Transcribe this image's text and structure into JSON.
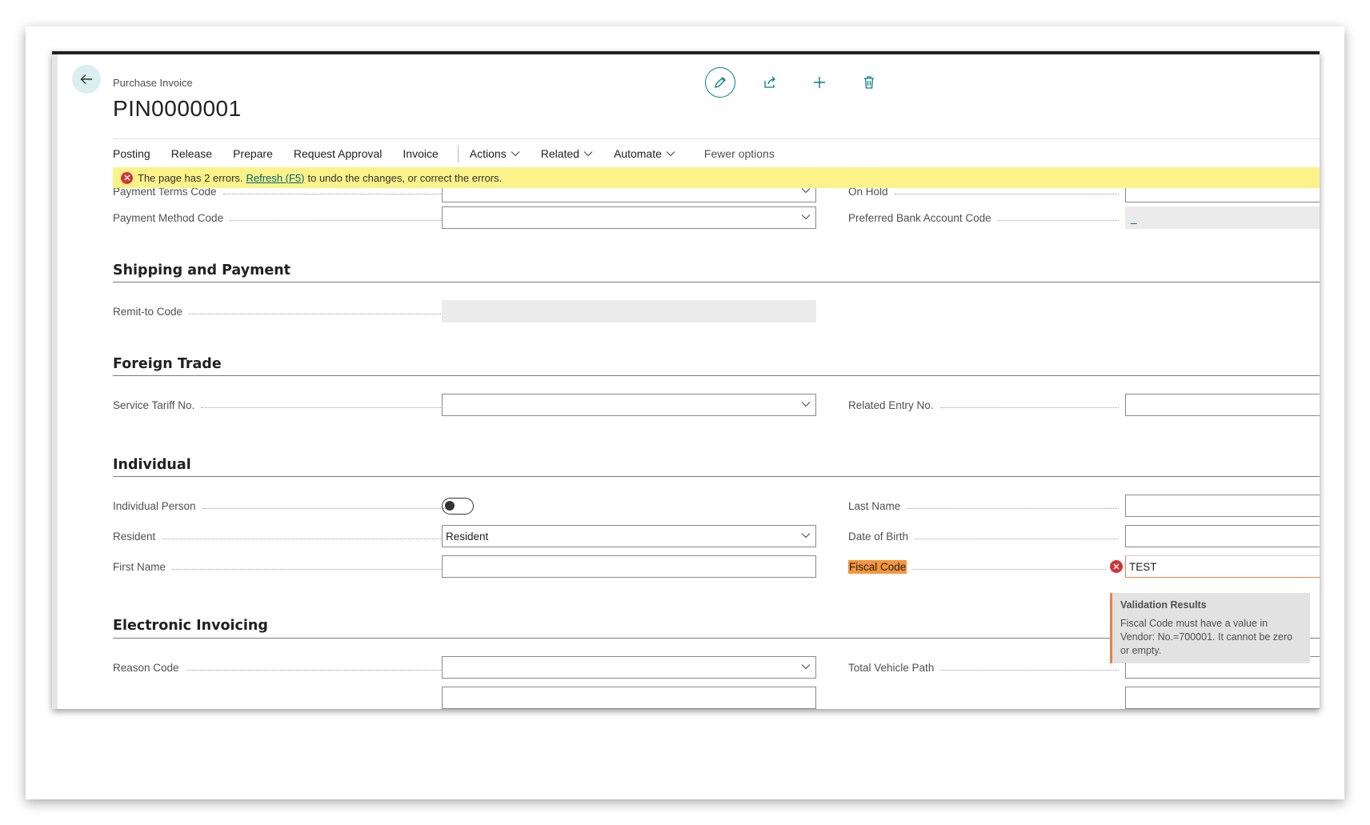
{
  "header": {
    "caption": "Purchase Invoice",
    "title": "PIN0000001"
  },
  "action_bar": {
    "items": [
      "Posting",
      "Release",
      "Prepare",
      "Request Approval",
      "Invoice"
    ],
    "menus": [
      "Actions",
      "Related",
      "Automate"
    ],
    "fewer": "Fewer options"
  },
  "error_bar": {
    "text_before": "The page has 2 errors.",
    "link": "Refresh (F5)",
    "text_after": "to undo the changes, or correct the errors."
  },
  "fields": {
    "payment_terms_code": "Payment Terms Code",
    "on_hold": "On Hold",
    "payment_method_code": "Payment Method Code",
    "preferred_bank_account_code": "Preferred Bank Account Code",
    "preferred_bank_value": "_",
    "remit_to_code": "Remit-to Code",
    "service_tariff_no": "Service Tariff No.",
    "related_entry_no": "Related Entry No.",
    "individual_person": "Individual Person",
    "last_name": "Last Name",
    "resident": "Resident",
    "resident_value": "Resident",
    "date_of_birth": "Date of Birth",
    "first_name": "First Name",
    "fiscal_code": "Fiscal Code",
    "fiscal_code_value": "TEST",
    "reason_code": "Reason Code",
    "total_vehicle_path": "Total Vehicle Path"
  },
  "sections": {
    "shipping": "Shipping and Payment",
    "foreign_trade": "Foreign Trade",
    "individual": "Individual",
    "electronic_invoicing": "Electronic Invoicing"
  },
  "tooltip": {
    "title": "Validation Results",
    "message": "Fiscal Code must have a value in Vendor: No.=700001. It cannot be zero or empty."
  },
  "colors": {
    "accent": "#00808a",
    "error": "#d13438",
    "error_bar": "#fbf38a",
    "highlight": "#f4963c"
  }
}
